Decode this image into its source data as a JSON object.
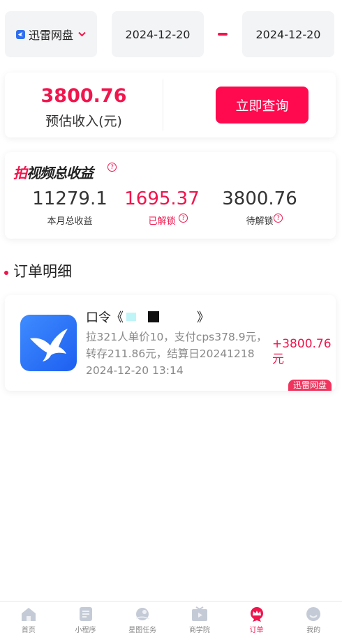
{
  "filter": {
    "app_name": "迅雷网盘",
    "start_date": "2024-12-20",
    "end_date": "2024-12-20"
  },
  "income": {
    "value": "3800.76",
    "label": "预估收入(元)",
    "query_button": "立即查询"
  },
  "earnings": {
    "title_accent": "拍",
    "title_rest": "视频总收益",
    "help_glyph": "?",
    "stats": [
      {
        "value": "11279.1",
        "label": "本月总收益"
      },
      {
        "value": "1695.37",
        "label": "已解锁"
      },
      {
        "value": "3800.76",
        "label": "待解锁"
      }
    ]
  },
  "orders_section": {
    "title": "订单明细"
  },
  "order": {
    "title_prefix": "口令《",
    "title_suffix": "》",
    "description": "拉321人单价10，支付cps378.9元，转存211.86元，结算日20241218",
    "time": "2024-12-20 13:14",
    "amount": "+3800.76元",
    "tag": "迅雷网盘",
    "icon": "xunlei-bird-icon"
  },
  "nav": {
    "items": [
      {
        "label": "首页",
        "icon": "home-icon"
      },
      {
        "label": "小程序",
        "icon": "document-icon"
      },
      {
        "label": "星图任务",
        "icon": "planet-icon"
      },
      {
        "label": "商学院",
        "icon": "tv-icon"
      },
      {
        "label": "订单",
        "icon": "crown-icon"
      },
      {
        "label": "我的",
        "icon": "face-icon"
      }
    ],
    "active_index": 4
  },
  "colors": {
    "accent": "#f0154d",
    "button": "#ff0a4f",
    "icon_blue": "#2f6ff0",
    "nav_inactive": "#c5cbd6"
  }
}
